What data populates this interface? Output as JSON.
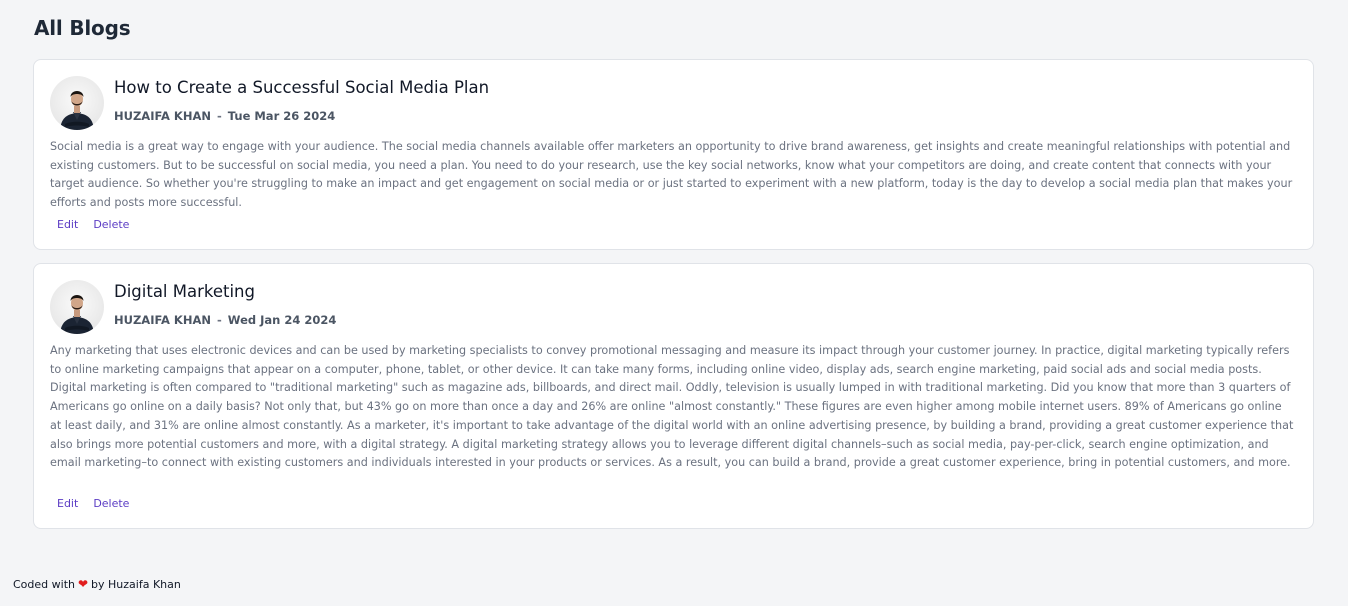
{
  "page": {
    "title": "All Blogs"
  },
  "posts": [
    {
      "title": "How to Create a Successful Social Media Plan",
      "author": "HUZAIFA KHAN",
      "separator": "-",
      "date": "Tue Mar 26 2024",
      "body": "Social media is a great way to engage with your audience. The social media channels available offer marketers an opportunity to drive brand awareness, get insights and create meaningful relationships with potential and existing customers. But to be successful on social media, you need a plan. You need to do your research, use the key social networks, know what your competitors are doing, and create content that connects with your target audience. So whether you're struggling to make an impact and get engagement on social media or or just started to experiment with a new platform, today is the day to develop a social media plan that makes your efforts and posts more successful.",
      "edit_label": "Edit",
      "delete_label": "Delete"
    },
    {
      "title": "Digital Marketing",
      "author": "HUZAIFA KHAN",
      "separator": "-",
      "date": "Wed Jan 24 2024",
      "body": "Any marketing that uses electronic devices and can be used by marketing specialists to convey promotional messaging and measure its impact through your customer journey. In practice, digital marketing typically refers to online marketing campaigns that appear on a computer, phone, tablet, or other device. It can take many forms, including online video, display ads, search engine marketing, paid social ads and social media posts. Digital marketing is often compared to \"traditional marketing\" such as magazine ads, billboards, and direct mail. Oddly, television is usually lumped in with traditional marketing. Did you know that more than 3 quarters of Americans go online on a daily basis? Not only that, but 43% go on more than once a day and 26% are online \"almost constantly.\" These figures are even higher among mobile internet users. 89% of Americans go online at least daily, and 31% are online almost constantly. As a marketer, it's important to take advantage of the digital world with an online advertising presence, by building a brand, providing a great customer experience that also brings more potential customers and more, with a digital strategy. A digital marketing strategy allows you to leverage different digital channels–such as social media, pay-per-click, search engine optimization, and email marketing–to connect with existing customers and individuals interested in your products or services. As a result, you can build a brand, provide a great customer experience, bring in potential customers, and more.",
      "edit_label": "Edit",
      "delete_label": "Delete"
    }
  ],
  "footer": {
    "prefix": "Coded with",
    "heart_icon": "heart-icon",
    "heart_color": "#e11d1d",
    "suffix": "by Huzaifa Khan"
  },
  "colors": {
    "background": "#f4f5f7",
    "card": "#ffffff",
    "link": "#5b3cc4",
    "body_text": "#6b7280"
  }
}
